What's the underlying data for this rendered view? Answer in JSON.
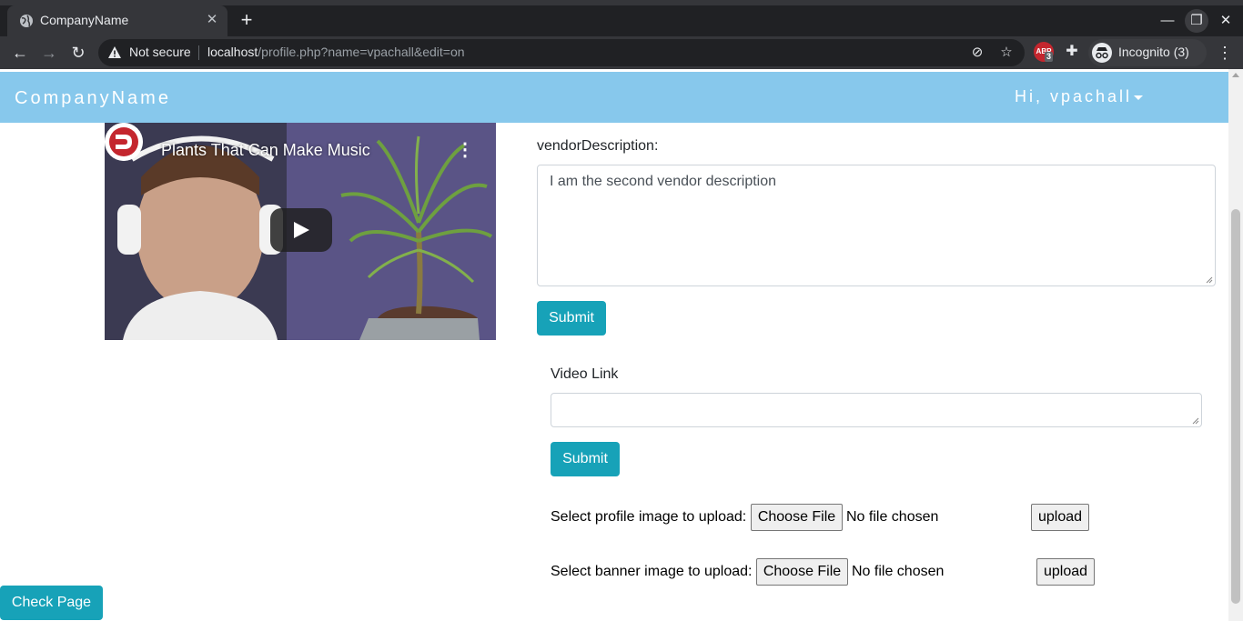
{
  "browser": {
    "tab_title": "CompanyName",
    "security_label": "Not secure",
    "url_host": "localhost",
    "url_path": "/profile.php?name=vpachall&edit=on",
    "extension_badge": "3",
    "incognito_label": "Incognito (3)"
  },
  "navbar": {
    "brand": "CompanyName",
    "user_menu": "Hi, vpachall"
  },
  "video": {
    "title": "Plants That Can Make Music"
  },
  "vendor": {
    "label": "vendorDescription:",
    "value": "I am the second vendor description",
    "submit_label": "Submit"
  },
  "video_link": {
    "label": "Video Link",
    "value": "",
    "submit_label": "Submit"
  },
  "profile_upload": {
    "label": "Select profile image to upload:",
    "choose_label": "Choose File",
    "status": "No file chosen",
    "upload_label": "upload"
  },
  "banner_upload": {
    "label": "Select banner image to upload:",
    "choose_label": "Choose File",
    "status": "No file chosen",
    "upload_label": "upload"
  },
  "check_page_label": "Check Page",
  "colors": {
    "navbar": "#87c8ec",
    "button": "#17a2b8"
  }
}
